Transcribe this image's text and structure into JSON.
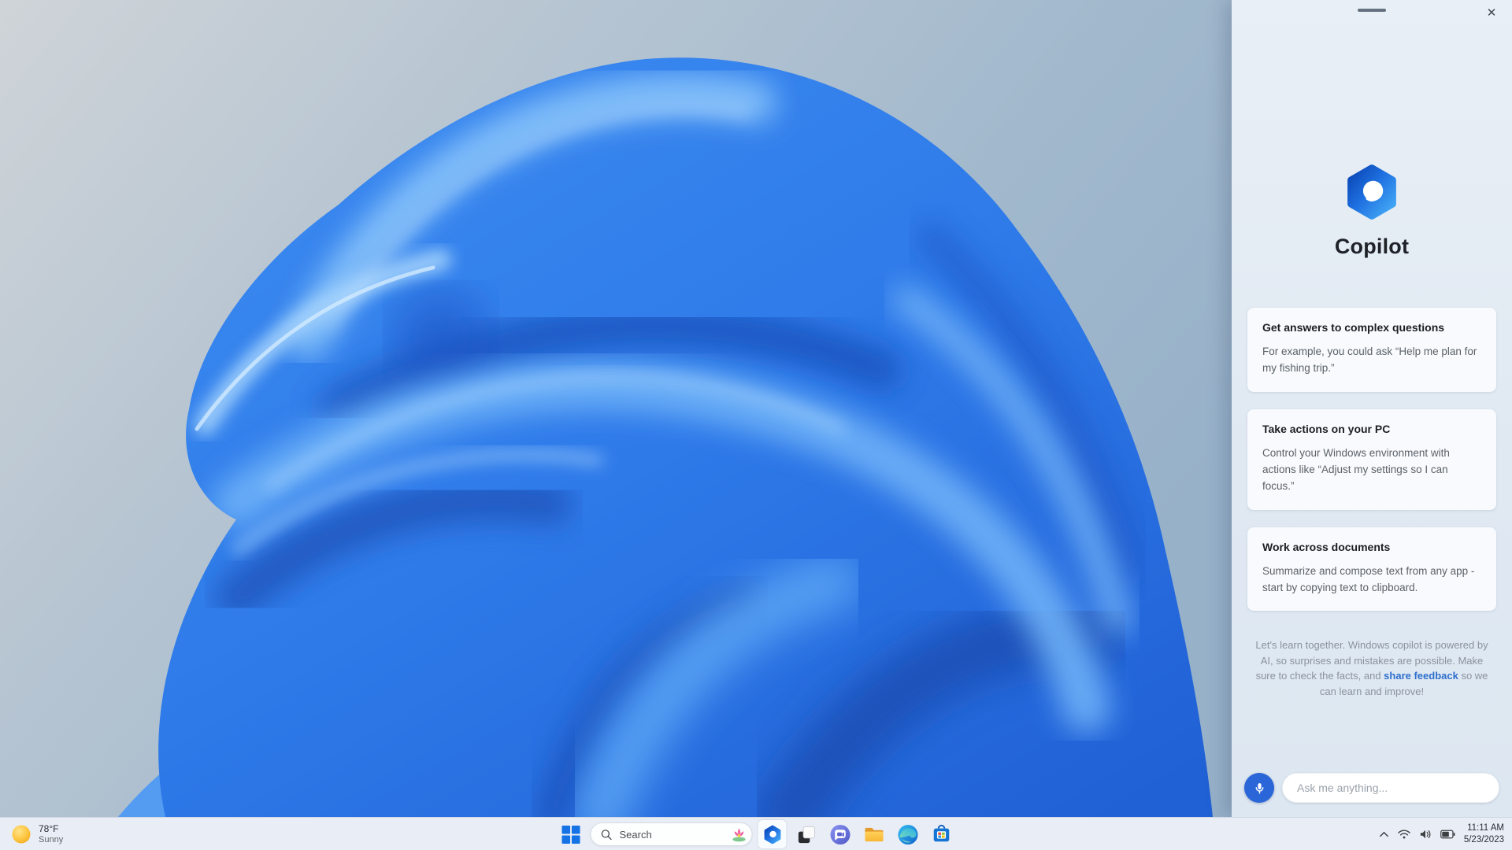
{
  "copilot_panel": {
    "title": "Copilot",
    "cards": [
      {
        "title": "Get answers to complex questions",
        "body": "For example, you could ask “Help me plan for my fishing trip.”"
      },
      {
        "title": "Take actions on your PC",
        "body": "Control your Windows environment with actions like “Adjust my settings so I can focus.”"
      },
      {
        "title": "Work across documents",
        "body": "Summarize and compose text from any app - start by copying text to clipboard."
      }
    ],
    "disclaimer": {
      "pre": "Let's learn together. Windows copilot is powered by AI, so surprises and mistakes are possible. Make sure to check the facts, and ",
      "link": "share feedback",
      "post": " so we can learn and improve!"
    },
    "input": {
      "placeholder": "Ask me anything..."
    }
  },
  "taskbar": {
    "weather": {
      "temp": "78°F",
      "condition": "Sunny"
    },
    "search": {
      "label": "Search"
    },
    "apps": [
      {
        "icon": "copilot-icon",
        "active": true
      },
      {
        "icon": "task-view-icon",
        "active": false
      },
      {
        "icon": "chat-icon",
        "active": false
      },
      {
        "icon": "file-explorer-icon",
        "active": false
      },
      {
        "icon": "edge-icon",
        "active": false
      },
      {
        "icon": "store-icon",
        "active": false
      }
    ],
    "tray": {
      "time": "11:11 AM",
      "date": "5/23/2023"
    }
  },
  "colors": {
    "bloom_blue": "#2e7ae9",
    "panel_bg": "#e2eaf3",
    "link_blue": "#2f6fce",
    "mic_button_blue": "#2a66d8",
    "sun_yellow": "#f8b500"
  }
}
